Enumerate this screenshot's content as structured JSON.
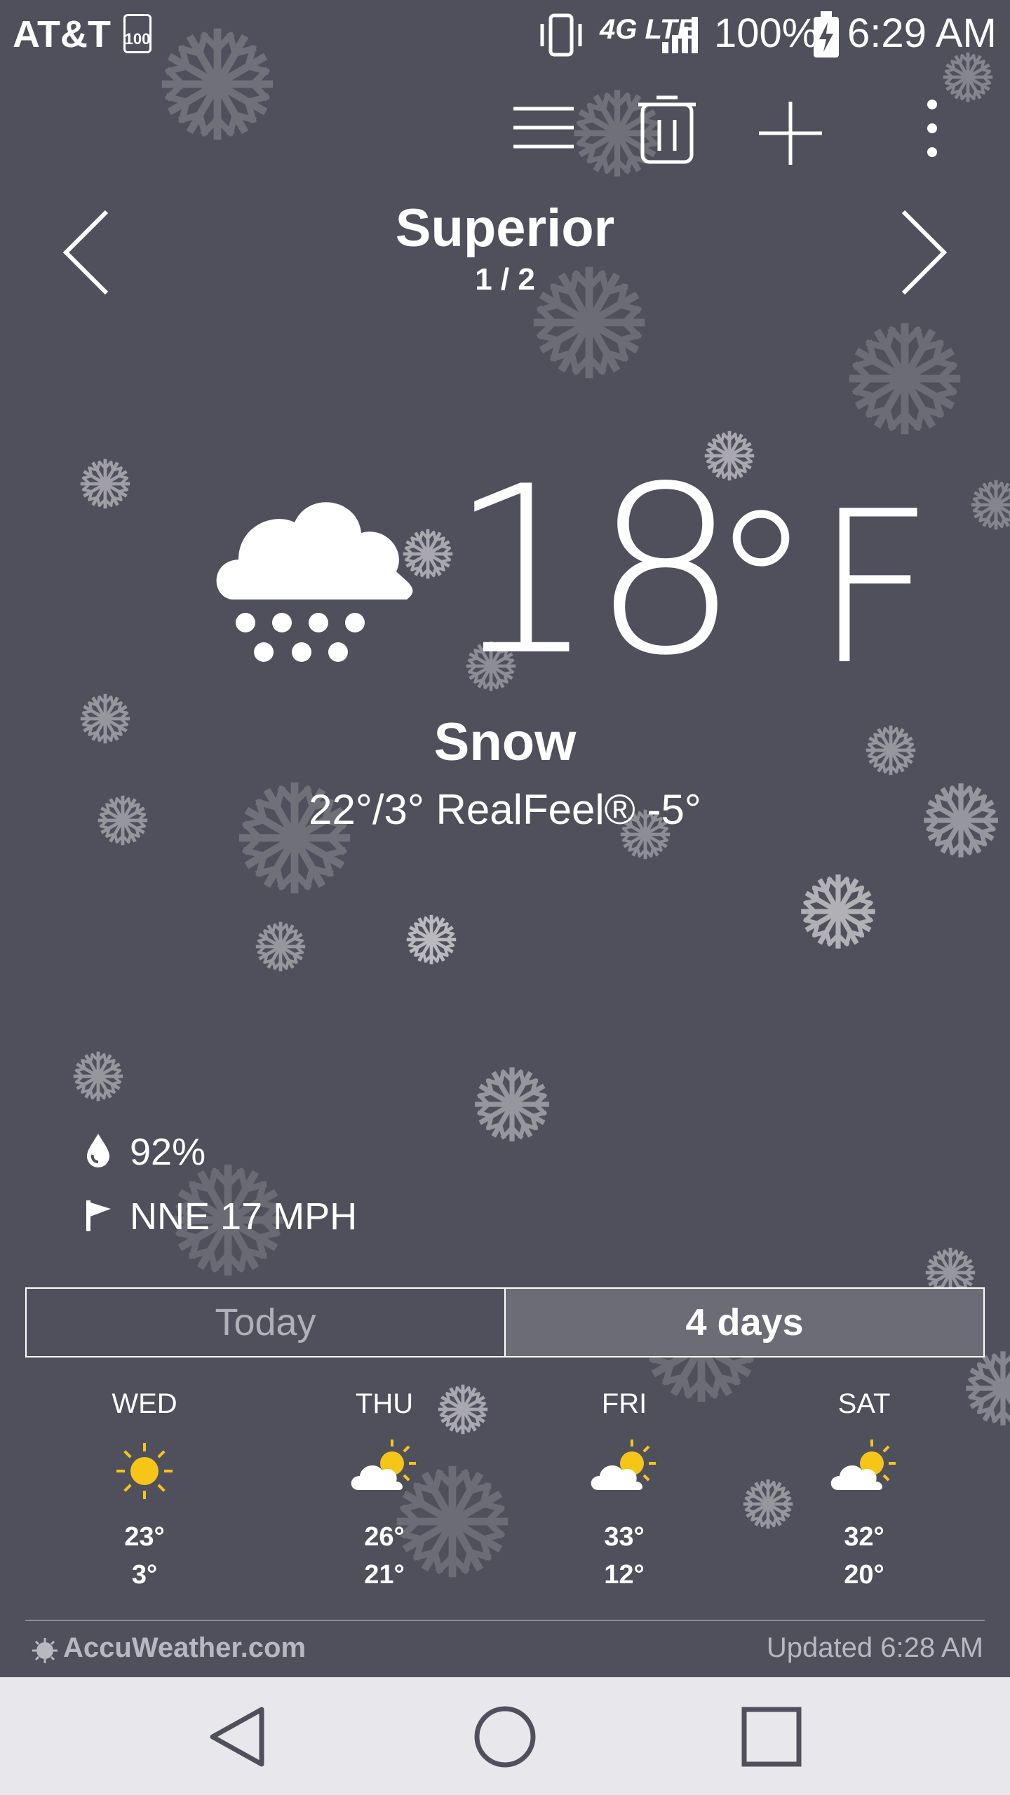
{
  "status_bar": {
    "carrier": "AT&T",
    "storage_badge": "100",
    "network": "4G LTE",
    "battery": "100%",
    "time": "6:29 AM"
  },
  "location": {
    "name": "Superior",
    "page": "1 / 2"
  },
  "current": {
    "temp": "18",
    "unit": "°F",
    "condition": "Snow",
    "hi_lo_realfeel": "22°/3° RealFeel® -5°",
    "humidity": "92%",
    "wind": "NNE 17 MPH",
    "icon": "snow-cloud-icon"
  },
  "tabs": {
    "today": "Today",
    "four_days": "4 days",
    "selected": "4 days"
  },
  "forecast": [
    {
      "day": "WED",
      "high": "23°",
      "low": "3°",
      "icon": "sunny-icon"
    },
    {
      "day": "THU",
      "high": "26°",
      "low": "21°",
      "icon": "partly-cloudy-icon"
    },
    {
      "day": "FRI",
      "high": "33°",
      "low": "12°",
      "icon": "partly-cloudy-icon"
    },
    {
      "day": "SAT",
      "high": "32°",
      "low": "20°",
      "icon": "partly-cloudy-icon"
    }
  ],
  "footer": {
    "brand": "AccuWeather.com",
    "updated": "Updated 6:28 AM"
  },
  "colors": {
    "background": "#50505c",
    "sun": "#f5c518",
    "navbar": "#e8e8ec"
  }
}
